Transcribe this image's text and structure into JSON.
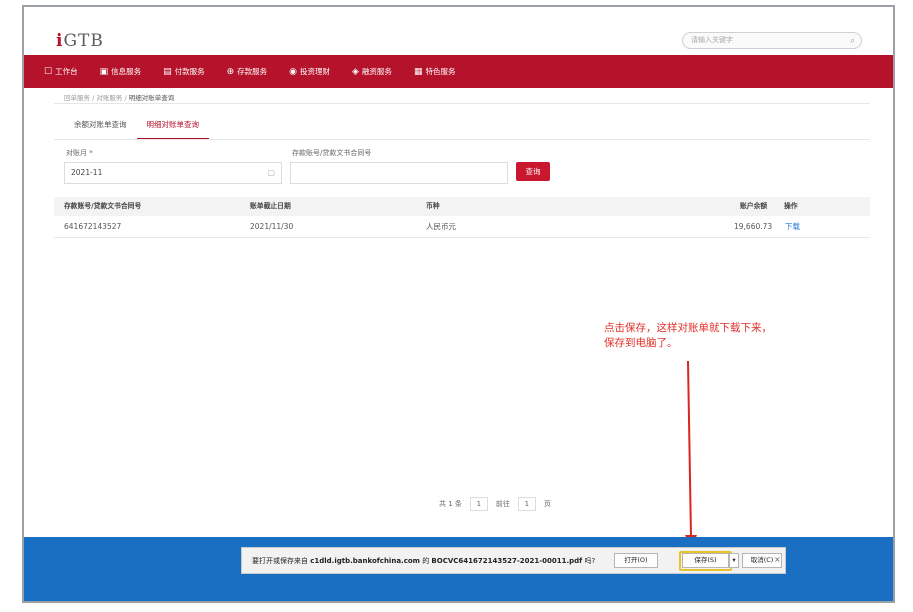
{
  "header": {
    "logo_i": "i",
    "logo_rest": "GTB",
    "search_placeholder": "请输入关键字"
  },
  "nav": {
    "items": [
      {
        "icon": "workbench-icon",
        "glyph": "☐",
        "label": "工作台"
      },
      {
        "icon": "info-icon",
        "glyph": "▣",
        "label": "信息服务"
      },
      {
        "icon": "payment-icon",
        "glyph": "▤",
        "label": "付款服务"
      },
      {
        "icon": "deposit-icon",
        "glyph": "⊕",
        "label": "存款服务"
      },
      {
        "icon": "invest-icon",
        "glyph": "◉",
        "label": "投资理财"
      },
      {
        "icon": "finance-icon",
        "glyph": "◈",
        "label": "融资服务"
      },
      {
        "icon": "special-icon",
        "glyph": "▦",
        "label": "特色服务"
      }
    ]
  },
  "breadcrumb": {
    "part1": "回单服务",
    "sep": "/",
    "part2": "对账服务",
    "current": "明细对账单查询"
  },
  "tabs": [
    {
      "label": "余额对账单查询",
      "active": false
    },
    {
      "label": "明细对账单查询",
      "active": true
    }
  ],
  "form": {
    "month_label": "对账月 *",
    "month_value": "2021-11",
    "account_label": "存款账号/贷款文书合同号",
    "query_button": "查询"
  },
  "table": {
    "headers": [
      "存款账号/贷款文书合同号",
      "账单截止日期",
      "币种",
      "账户余额",
      "操作"
    ],
    "rows": [
      [
        "641672143527",
        "2021/11/30",
        "人民币元",
        "19,660.73",
        "下载"
      ]
    ]
  },
  "annotation": {
    "text": "点击保存，这样对账单就下载下来，保存到电脑了。"
  },
  "pager": {
    "total": "共 1 条",
    "page": "1",
    "goto_label": "前往",
    "goto_value": "1",
    "page_unit": "页"
  },
  "download_bar": {
    "prefix": "要打开或保存来自",
    "host": "c1dld.igtb.bankofchina.com",
    "middle": "的",
    "filename": "BOCVC641672143527-2021-00011.pdf",
    "suffix": "吗?",
    "open": "打开(O)",
    "save": "保存(S)",
    "more": "▾",
    "cancel": "取消(C)",
    "close": "×"
  },
  "colors": {
    "brand_red": "#b5132b",
    "blue_bar": "#1a6fc2",
    "annotation_red": "#e0302a"
  }
}
